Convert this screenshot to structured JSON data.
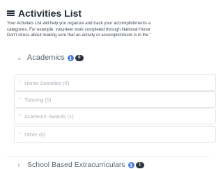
{
  "header": {
    "title": "Activities List",
    "description_lines": [
      "Your Activities List will help you organize and track your accomplishments a",
      "categories. For example, volunteer work completed through National Honor",
      "Don't stress about making sure that an activity or accomplishment is in the \""
    ]
  },
  "sections": [
    {
      "label": "Academics",
      "count": "0",
      "expanded": true,
      "items": [
        "Honor Societies (0)",
        "Tutoring (0)",
        "Academic Awards (1)",
        "Other (0)"
      ]
    },
    {
      "label": "School Based Extracurriculars",
      "count": "1",
      "expanded": false
    }
  ],
  "colors": {
    "info_badge": "#4e7fe0",
    "count_badge": "#2d3440"
  },
  "icons": {
    "header": "list-icon",
    "info": "info-icon",
    "expand": "chevron-icon"
  }
}
